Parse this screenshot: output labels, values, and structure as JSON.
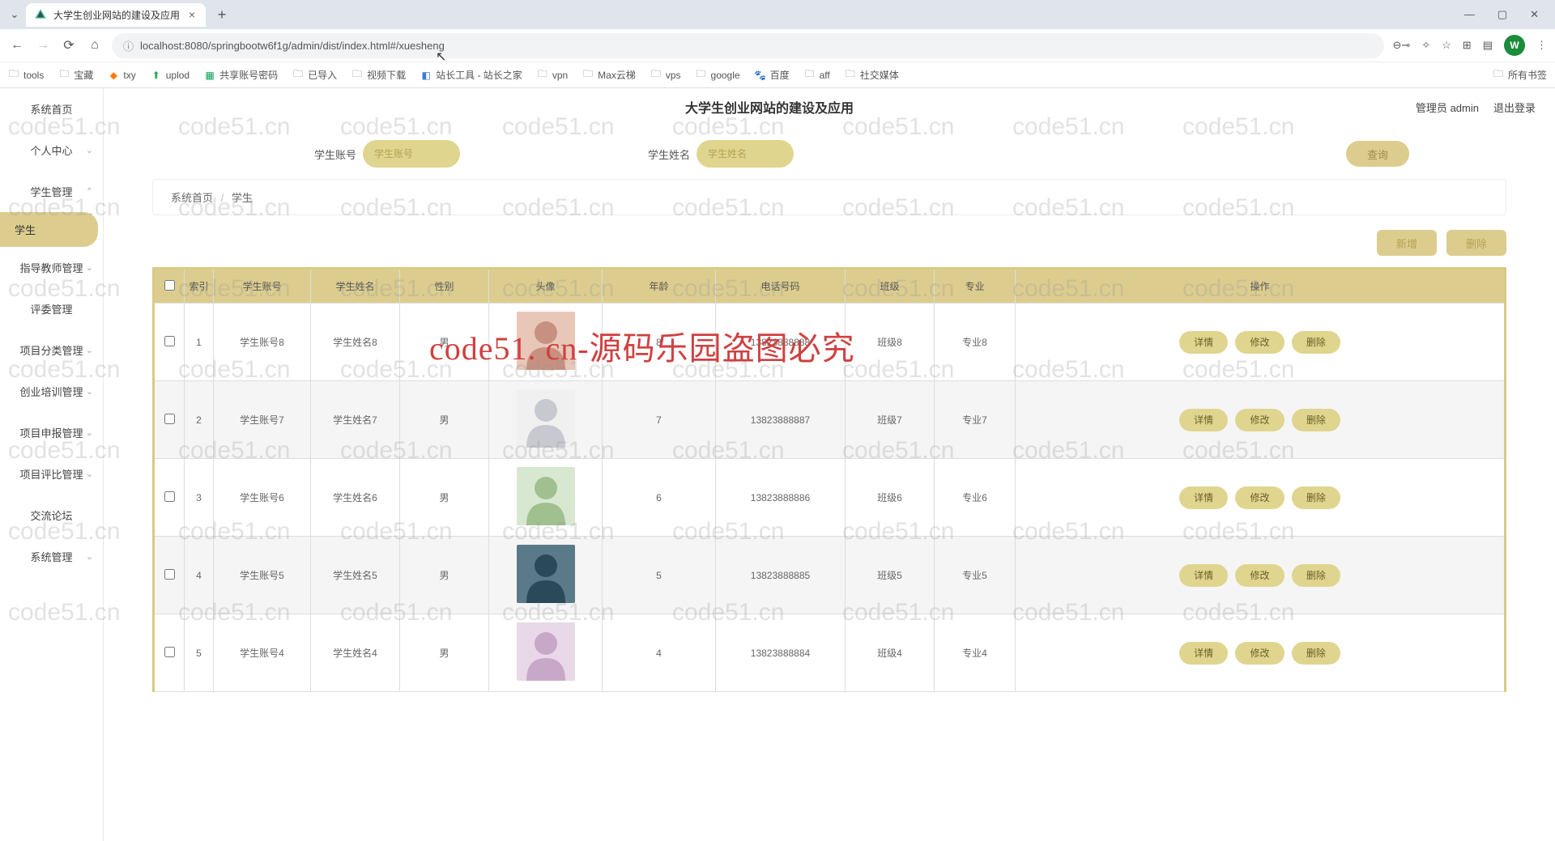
{
  "browser": {
    "tab_title": "大学生创业网站的建设及应用",
    "url": "localhost:8080/springbootw6f1g/admin/dist/index.html#/xuesheng",
    "bookmarks": [
      "tools",
      "宝藏",
      "txy",
      "uplod",
      "共享账号密码",
      "已导入",
      "视频下载",
      "站长工具 - 站长之家",
      "vpn",
      "Max云梯",
      "vps",
      "google",
      "百度",
      "aff",
      "社交媒体"
    ],
    "all_bookmarks": "所有书签",
    "profile_initial": "W"
  },
  "sidebar": {
    "items": [
      {
        "label": "系统首页",
        "expandable": false
      },
      {
        "label": "个人中心",
        "expandable": true
      },
      {
        "label": "学生管理",
        "expandable": true,
        "expanded": true
      },
      {
        "label": "指导教师管理",
        "expandable": true
      },
      {
        "label": "评委管理",
        "expandable": false
      },
      {
        "label": "项目分类管理",
        "expandable": true
      },
      {
        "label": "创业培训管理",
        "expandable": true
      },
      {
        "label": "项目申报管理",
        "expandable": true
      },
      {
        "label": "项目评比管理",
        "expandable": true
      },
      {
        "label": "交流论坛",
        "expandable": false
      },
      {
        "label": "系统管理",
        "expandable": true
      }
    ],
    "sub_active": "学生"
  },
  "header": {
    "title": "大学生创业网站的建设及应用",
    "role": "管理员",
    "username": "admin",
    "logout": "退出登录"
  },
  "search": {
    "acc_label": "学生账号",
    "acc_placeholder": "学生账号",
    "name_label": "学生姓名",
    "name_placeholder": "学生姓名",
    "query_btn": "查询"
  },
  "breadcrumb": {
    "home": "系统首页",
    "current": "学生"
  },
  "actions": {
    "add": "新增",
    "del": "删除"
  },
  "table": {
    "headers": [
      "索引",
      "学生账号",
      "学生姓名",
      "性别",
      "头像",
      "年龄",
      "电话号码",
      "班级",
      "专业",
      "操作"
    ],
    "row_buttons": {
      "detail": "详情",
      "edit": "修改",
      "delete": "删除"
    },
    "rows": [
      {
        "idx": "1",
        "acc": "学生账号8",
        "name": "学生姓名8",
        "sex": "男",
        "age": "8",
        "phone": "13823888888",
        "class": "班级8",
        "major": "专业8"
      },
      {
        "idx": "2",
        "acc": "学生账号7",
        "name": "学生姓名7",
        "sex": "男",
        "age": "7",
        "phone": "13823888887",
        "class": "班级7",
        "major": "专业7"
      },
      {
        "idx": "3",
        "acc": "学生账号6",
        "name": "学生姓名6",
        "sex": "男",
        "age": "6",
        "phone": "13823888886",
        "class": "班级6",
        "major": "专业6"
      },
      {
        "idx": "4",
        "acc": "学生账号5",
        "name": "学生姓名5",
        "sex": "男",
        "age": "5",
        "phone": "13823888885",
        "class": "班级5",
        "major": "专业5"
      },
      {
        "idx": "5",
        "acc": "学生账号4",
        "name": "学生姓名4",
        "sex": "男",
        "age": "4",
        "phone": "13823888884",
        "class": "班级4",
        "major": "专业4"
      }
    ]
  },
  "watermark": {
    "small": "code51.cn",
    "main": "code51. cn-源码乐园盗图必究"
  }
}
